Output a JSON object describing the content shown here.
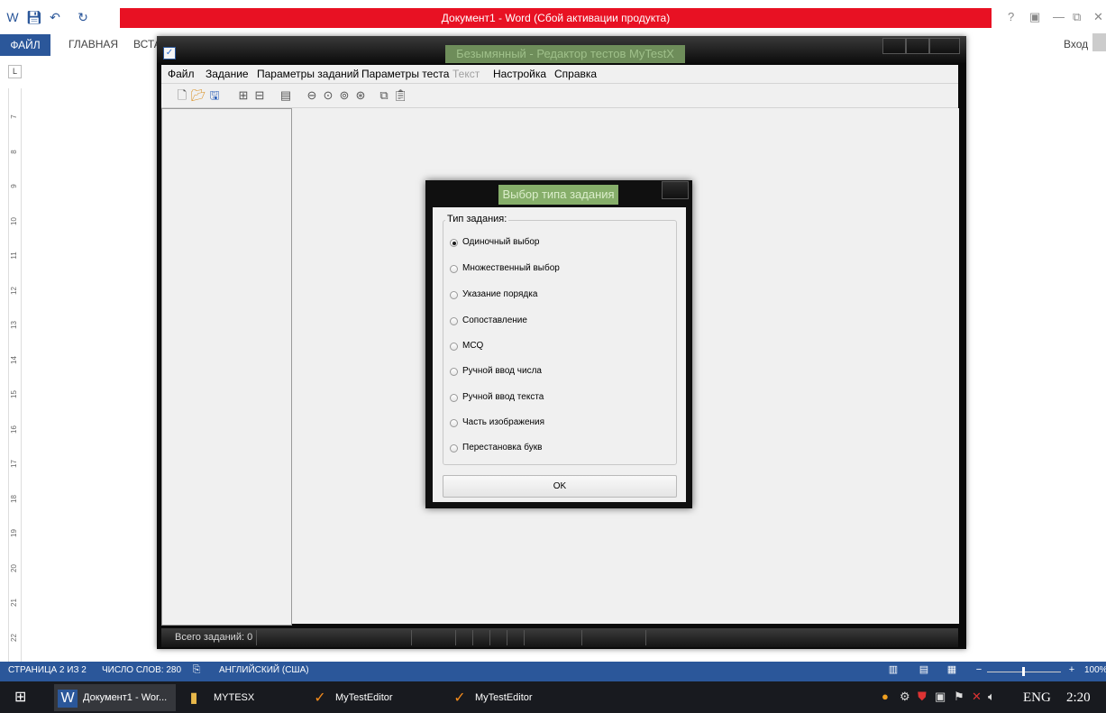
{
  "word": {
    "title": "Документ1 - Word (Сбой активации продукта)",
    "tabs": [
      "ФАЙЛ",
      "ГЛАВНАЯ",
      "ВСТА"
    ],
    "login": "Вход",
    "sys_buttons": [
      "?",
      "▣",
      "—",
      "⧉",
      "✕"
    ],
    "ruler_numbers": [
      "7",
      "8",
      "9",
      "10",
      "11",
      "12",
      "13",
      "14",
      "15",
      "16",
      "17",
      "18",
      "19",
      "20",
      "21",
      "22"
    ],
    "status": {
      "page": "СТРАНИЦА 2 ИЗ 2",
      "words": "ЧИСЛО СЛОВ: 280",
      "language": "АНГЛИЙСКИЙ (США)",
      "zoom": "100%"
    }
  },
  "mytest": {
    "title": "Безымянный - Редактор тестов MyTestX",
    "menu": [
      "Файл",
      "Задание",
      "Параметры заданий",
      "Параметры теста",
      "Текст",
      "Настройка",
      "Справка"
    ],
    "status_text": "Всего заданий: 0"
  },
  "dialog": {
    "title": "Выбор типа задания",
    "group_label": "Тип задания:",
    "options": [
      "Одиночный выбор",
      "Множественный выбор",
      "Указание порядка",
      "Сопоставление",
      "MCQ",
      "Ручной ввод числа",
      "Ручной ввод текста",
      "Часть изображения",
      "Перестановка букв"
    ],
    "selected_index": 0,
    "ok_label": "OK"
  },
  "taskbar": {
    "items": [
      "Документ1 - Wor...",
      "MYTESX",
      "MyTestEditor",
      "MyTestEditor"
    ],
    "language": "ENG",
    "time": "2:20"
  },
  "colors": {
    "word_blue": "#2b579a",
    "activation_red": "#e81123",
    "dialog_title_green": "#86ae6a"
  }
}
